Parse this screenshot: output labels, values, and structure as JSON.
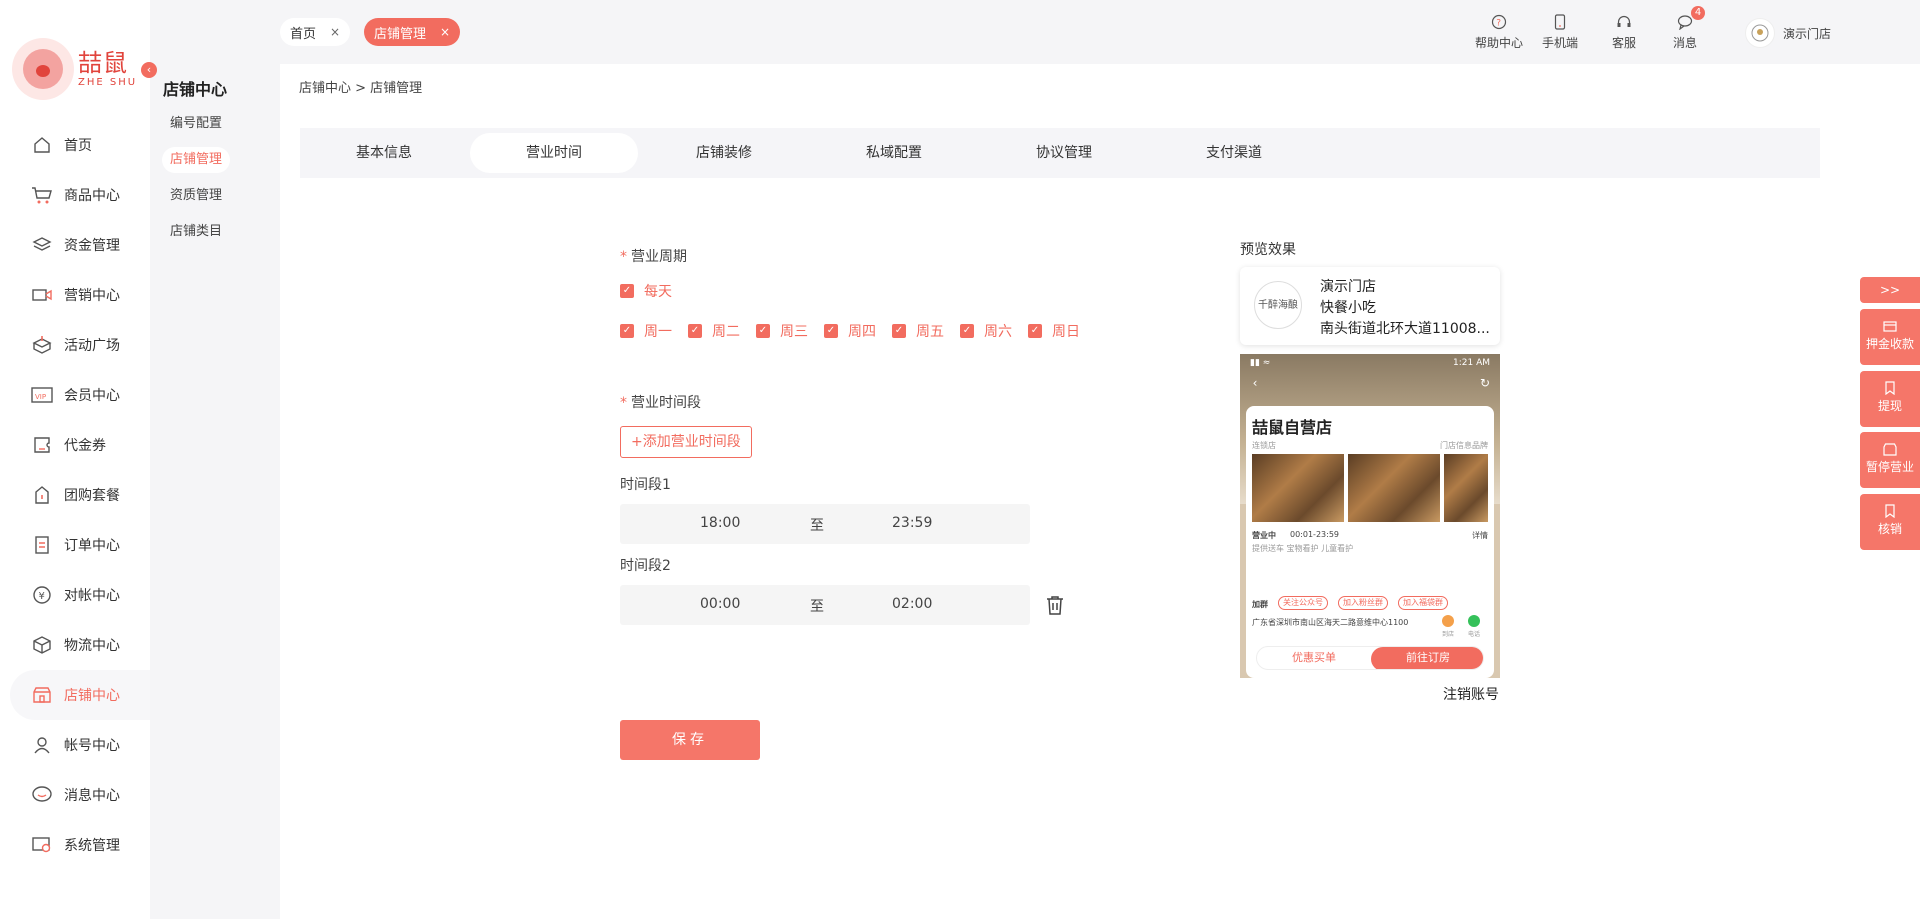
{
  "app": {
    "logo_cn": "喆鼠",
    "logo_en": "ZHE SHU"
  },
  "sidebar": {
    "items": [
      {
        "label": "首页",
        "icon": "home-icon"
      },
      {
        "label": "商品中心",
        "icon": "cart-icon"
      },
      {
        "label": "资金管理",
        "icon": "layers-icon"
      },
      {
        "label": "营销中心",
        "icon": "video-icon"
      },
      {
        "label": "活动广场",
        "icon": "gift-box-icon"
      },
      {
        "label": "会员中心",
        "icon": "vip-card-icon"
      },
      {
        "label": "代金券",
        "icon": "coupon-icon"
      },
      {
        "label": "团购套餐",
        "icon": "bag-icon"
      },
      {
        "label": "订单中心",
        "icon": "order-icon"
      },
      {
        "label": "对帐中心",
        "icon": "yuan-icon"
      },
      {
        "label": "物流中心",
        "icon": "package-icon"
      },
      {
        "label": "店铺中心",
        "icon": "store-icon"
      },
      {
        "label": "帐号中心",
        "icon": "user-icon"
      },
      {
        "label": "消息中心",
        "icon": "chat-icon"
      },
      {
        "label": "系统管理",
        "icon": "settings-screen-icon"
      }
    ],
    "active_index": 11
  },
  "subnav": {
    "title": "店铺中心",
    "items": [
      "编号配置",
      "店铺管理",
      "资质管理",
      "店铺类目"
    ],
    "active": "店铺管理"
  },
  "topbar": {
    "tabs": [
      {
        "label": "首页",
        "close": "×"
      },
      {
        "label": "店铺管理",
        "close": "×"
      }
    ],
    "tools": [
      {
        "label": "帮助中心",
        "icon": "help-icon"
      },
      {
        "label": "手机端",
        "icon": "mobile-icon"
      },
      {
        "label": "客服",
        "icon": "headset-icon"
      },
      {
        "label": "消息",
        "icon": "message-icon",
        "badge": "4"
      }
    ],
    "user_name": "演示门店"
  },
  "breadcrumb": "店铺中心  > 店铺管理",
  "tabs": [
    "基本信息",
    "营业时间",
    "店铺装修",
    "私域配置",
    "协议管理",
    "支付渠道"
  ],
  "active_tab": "营业时间",
  "form": {
    "period_label": "营业周期",
    "everyday": "每天",
    "weekdays": [
      "周一",
      "周二",
      "周三",
      "周四",
      "周五",
      "周六",
      "周日"
    ],
    "timeslot_label": "营业时间段",
    "add_button": "+添加营业时间段",
    "slots": [
      {
        "title": "时间段1",
        "start": "18:00",
        "sep": "至",
        "end": "23:59"
      },
      {
        "title": "时间段2",
        "start": "00:00",
        "sep": "至",
        "end": "02:00"
      }
    ],
    "save_button": "保存"
  },
  "preview": {
    "title": "预览效果",
    "store_name": "演示门店",
    "store_category": "快餐小吃",
    "store_address": "南头街道北环大道11008...",
    "logo_text": "千醉海酿",
    "phone": {
      "time": "1:21 AM",
      "name": "喆鼠自营店",
      "sub_left": "连锁店",
      "sub_right": "门店信息品牌",
      "status": "营业中",
      "hours": "00:01-23:59",
      "details": "详情",
      "features": "提供送车   宝物看护   儿童看护",
      "join": "加群",
      "chips": [
        "关注公众号",
        "加入粉丝群",
        "加入福袋群"
      ],
      "address": "广东省深圳市南山区海天二路意维中心1100",
      "nav_label": "到店",
      "call_label": "电话",
      "btn_left": "优惠买单",
      "btn_right": "前往订房"
    },
    "logout": "注销账号"
  },
  "float_buttons": {
    "collapse": ">>",
    "items": [
      "押金收款",
      "提现",
      "暂停营业",
      "核销"
    ]
  },
  "colors": {
    "accent": "#f26c5f",
    "accent_light": "#f57669"
  }
}
